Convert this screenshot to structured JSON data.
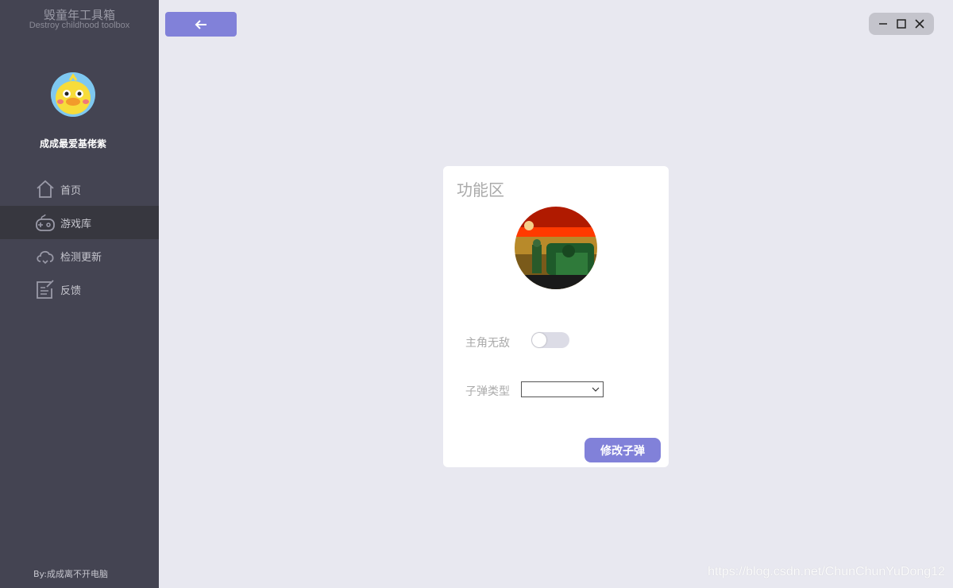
{
  "app": {
    "title": "毁童年工具箱",
    "subtitle": "Destroy childhood toolbox"
  },
  "user": {
    "name": "成成最爱基佬紫"
  },
  "nav": {
    "items": [
      {
        "label": "首页",
        "icon": "home-icon",
        "active": false
      },
      {
        "label": "游戏库",
        "icon": "gamepad-icon",
        "active": true
      },
      {
        "label": "检测更新",
        "icon": "cloud-update-icon",
        "active": false
      },
      {
        "label": "反馈",
        "icon": "feedback-icon",
        "active": false
      }
    ]
  },
  "footer": {
    "credit": "By:成成离不开电脑"
  },
  "toolbar": {
    "back_icon": "arrow-left-icon"
  },
  "window_controls": [
    "minimize-icon",
    "maximize-icon",
    "close-icon"
  ],
  "card": {
    "title": "功能区",
    "invincible_label": "主角无敌",
    "invincible_on": false,
    "bullet_label": "子弹类型",
    "bullet_value": "",
    "modify_button": "修改子弹"
  },
  "watermark": "https://blog.csdn.net/ChunChunYuDong12",
  "colors": {
    "accent": "#8181d9",
    "sidebar": "#444452",
    "sidebar_active": "#37373f",
    "background": "#e8e8f0"
  }
}
